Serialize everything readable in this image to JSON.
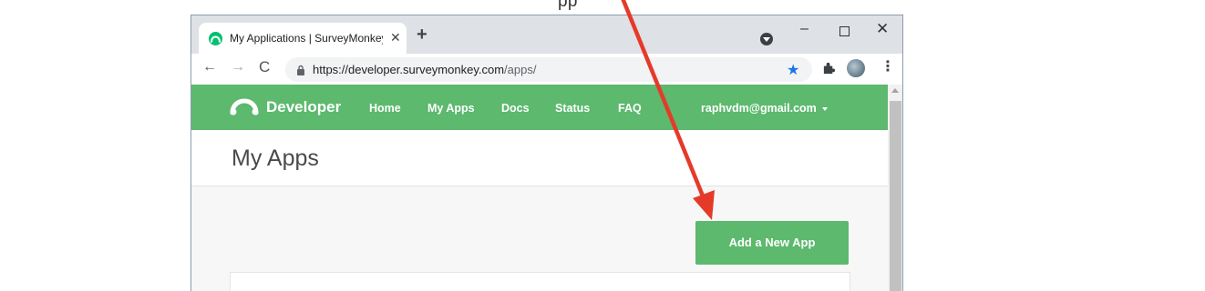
{
  "top_fragment": "pp",
  "browser": {
    "tab_title": "My Applications | SurveyMonkey",
    "tab_close": "✕",
    "new_tab": "+",
    "window_min": "–",
    "window_close": "✕",
    "nav_back": "←",
    "nav_forward": "→",
    "nav_reload": "C",
    "url_host": "https://developer.surveymonkey.com",
    "url_path": "/apps/",
    "bookmark_star": "★",
    "menu_kebab": "⋮"
  },
  "site": {
    "brand": "Developer",
    "nav": [
      "Home",
      "My Apps",
      "Docs",
      "Status",
      "FAQ"
    ],
    "user_email": "raphvdm@gmail.com"
  },
  "page": {
    "title": "My Apps",
    "add_button": "Add a New App"
  },
  "colors": {
    "brand_green": "#5cb96e",
    "favicon_green": "#00bf6f",
    "annotation_red": "#e53a2a",
    "link_blue": "#1a73e8"
  }
}
